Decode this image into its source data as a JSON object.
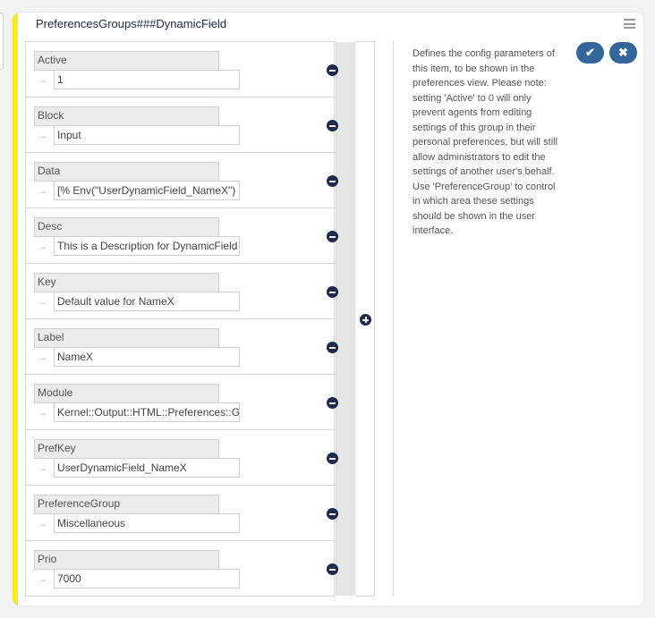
{
  "card": {
    "title": "PreferencesGroups###DynamicField"
  },
  "icons": {
    "menu": "hamburger-icon",
    "arrow": "→",
    "remove": "minus-circle-icon",
    "add": "plus-circle-icon",
    "confirm_glyph": "✔",
    "cancel_glyph": "✖"
  },
  "colors": {
    "accent": "#f7ea1f",
    "button": "#336699",
    "icon_dark": "#1c2a4d"
  },
  "fields": [
    {
      "key": "Active",
      "value": "1"
    },
    {
      "key": "Block",
      "value": "Input"
    },
    {
      "key": "Data",
      "value": "[% Env(\"UserDynamicField_NameX\") %]"
    },
    {
      "key": "Desc",
      "value": "This is a Description for DynamicField"
    },
    {
      "key": "Key",
      "value": "Default value for NameX"
    },
    {
      "key": "Label",
      "value": "NameX"
    },
    {
      "key": "Module",
      "value": "Kernel::Output::HTML::Preferences::Generic"
    },
    {
      "key": "PrefKey",
      "value": "UserDynamicField_NameX"
    },
    {
      "key": "PreferenceGroup",
      "value": "Miscellaneous"
    },
    {
      "key": "Prio",
      "value": "7000"
    }
  ],
  "description": "Defines the config parameters of this item, to be shown in the preferences view. Please note: setting 'Active' to 0 will only prevent agents from editing settings of this group in their personal preferences, but will still allow administrators to edit the settings of another user's behalf. Use 'PreferenceGroup' to control in which area these settings should be shown in the user interface."
}
